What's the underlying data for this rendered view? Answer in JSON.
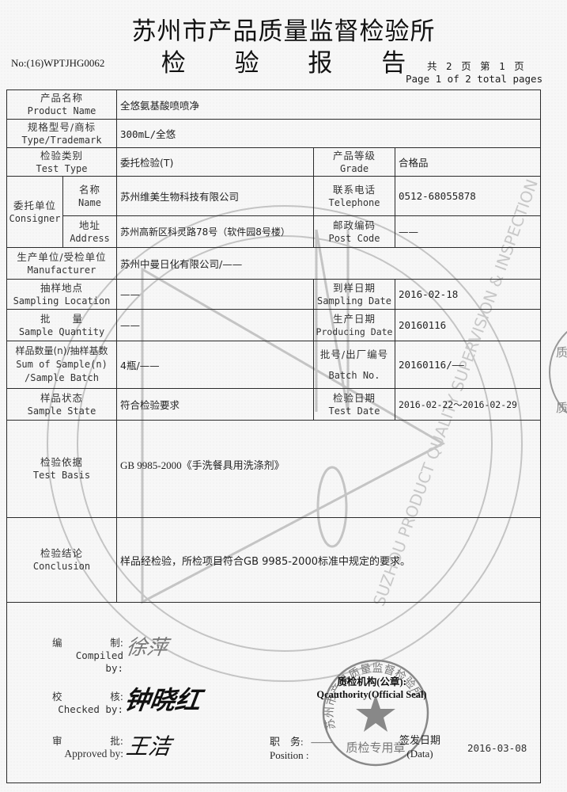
{
  "header": {
    "institute": "苏州市产品质量监督检验所",
    "report_title": "检 验 报 告",
    "report_no": "No:(16)WPTJHG0062",
    "page_cn": "共 2 页 第 1 页",
    "page_en": "Page 1 of 2 total pages"
  },
  "fields": {
    "product_name": {
      "label_cn": "产品名称",
      "label_en": "Product Name",
      "value": "全悠氨基酸喷喷净"
    },
    "type_trademark": {
      "label_cn": "规格型号/商标",
      "label_en": "Type/Trademark",
      "value": "300mL/全悠"
    },
    "test_type": {
      "label_cn": "检验类别",
      "label_en": "Test Type",
      "value": "委托检验(T)"
    },
    "grade": {
      "label_cn": "产品等级",
      "label_en": "Grade",
      "value": "合格品"
    },
    "consigner": {
      "label_cn": "委托单位",
      "label_en": "Consigner",
      "name": {
        "label_cn": "名称",
        "label_en": "Name",
        "value": "苏州维美生物科技有限公司"
      },
      "address": {
        "label_cn": "地址",
        "label_en": "Address",
        "value": "苏州高新区科灵路78号（软件园8号楼）"
      }
    },
    "telephone": {
      "label_cn": "联系电话",
      "label_en": "Telephone",
      "value": "0512-68055878"
    },
    "post_code": {
      "label_cn": "邮政编码",
      "label_en": "Post Code",
      "value": "——"
    },
    "manufacturer": {
      "label_cn": "生产单位/受检单位",
      "label_en": "Manufacturer",
      "value": "苏州中曼日化有限公司/——"
    },
    "sampling_location": {
      "label_cn": "抽样地点",
      "label_en": "Sampling Location",
      "value": "——"
    },
    "sampling_date": {
      "label_cn": "到样日期",
      "label_en": "Sampling Date",
      "value": "2016-02-18"
    },
    "sample_quantity": {
      "label_cn": "批　　量",
      "label_en": "Sample Quantity",
      "value": "——"
    },
    "producing_date": {
      "label_cn": "生产日期",
      "label_en": "Producing Date",
      "value": "20160116"
    },
    "sample_sum": {
      "label_cn": "样品数量(n)/抽样基数",
      "label_en_1": "Sum of Sample(n)",
      "label_en_2": "/Sample Batch",
      "value": "4瓶/——"
    },
    "batch_no": {
      "label_cn": "批号/出厂编号",
      "label_en": "Batch No.",
      "value": "20160116/——"
    },
    "sample_state": {
      "label_cn": "样品状态",
      "label_en": "Sample State",
      "value": "符合检验要求"
    },
    "test_date": {
      "label_cn": "检验日期",
      "label_en": "Test Date",
      "value": "2016-02-22～2016-02-29"
    },
    "test_basis": {
      "label_cn": "检验依据",
      "label_en": "Test Basis",
      "value": "GB 9985-2000《手洗餐具用洗涤剂》"
    },
    "conclusion": {
      "label_cn": "检验结论",
      "label_en": "Conclusion",
      "value": "样品经检验，所检项目符合GB 9985-2000标准中规定的要求。"
    }
  },
  "signatures": {
    "compiled": {
      "label_cn_1": "编",
      "label_cn_2": "制:",
      "label_en": "Compiled by:",
      "signature": "徐萍"
    },
    "checked": {
      "label_cn_1": "校",
      "label_cn_2": "核:",
      "label_en": "Checked by:",
      "signature": "钟晓红"
    },
    "approved": {
      "label_cn_1": "审",
      "label_cn_2": "批:",
      "label_en": "Approved by:",
      "signature": "王洁"
    },
    "seal": {
      "label_cn": "质检机构(公章):",
      "label_en": "Qcauthority(Official Seal)",
      "seal_text_top": "苏州市产品质量监督检验所",
      "seal_text_bottom": "质检专用章"
    },
    "position": {
      "label_cn": "职　务:",
      "label_en": "Position :",
      "value": "——"
    },
    "issue_date": {
      "label_cn": "签发日期",
      "label_en": "(Data)",
      "value": "2016-03-08"
    }
  },
  "watermark": {
    "text": "SUZHOU PRODUCT QUALITY SUPERVISION & INSPECTION",
    "cn_text": "苏州市产品质量监督检验所"
  },
  "colors": {
    "ink": "#1a1a1a",
    "border": "#2a2a2a",
    "watermark": "#bdbdbd",
    "paper": "#f7f7f7"
  }
}
